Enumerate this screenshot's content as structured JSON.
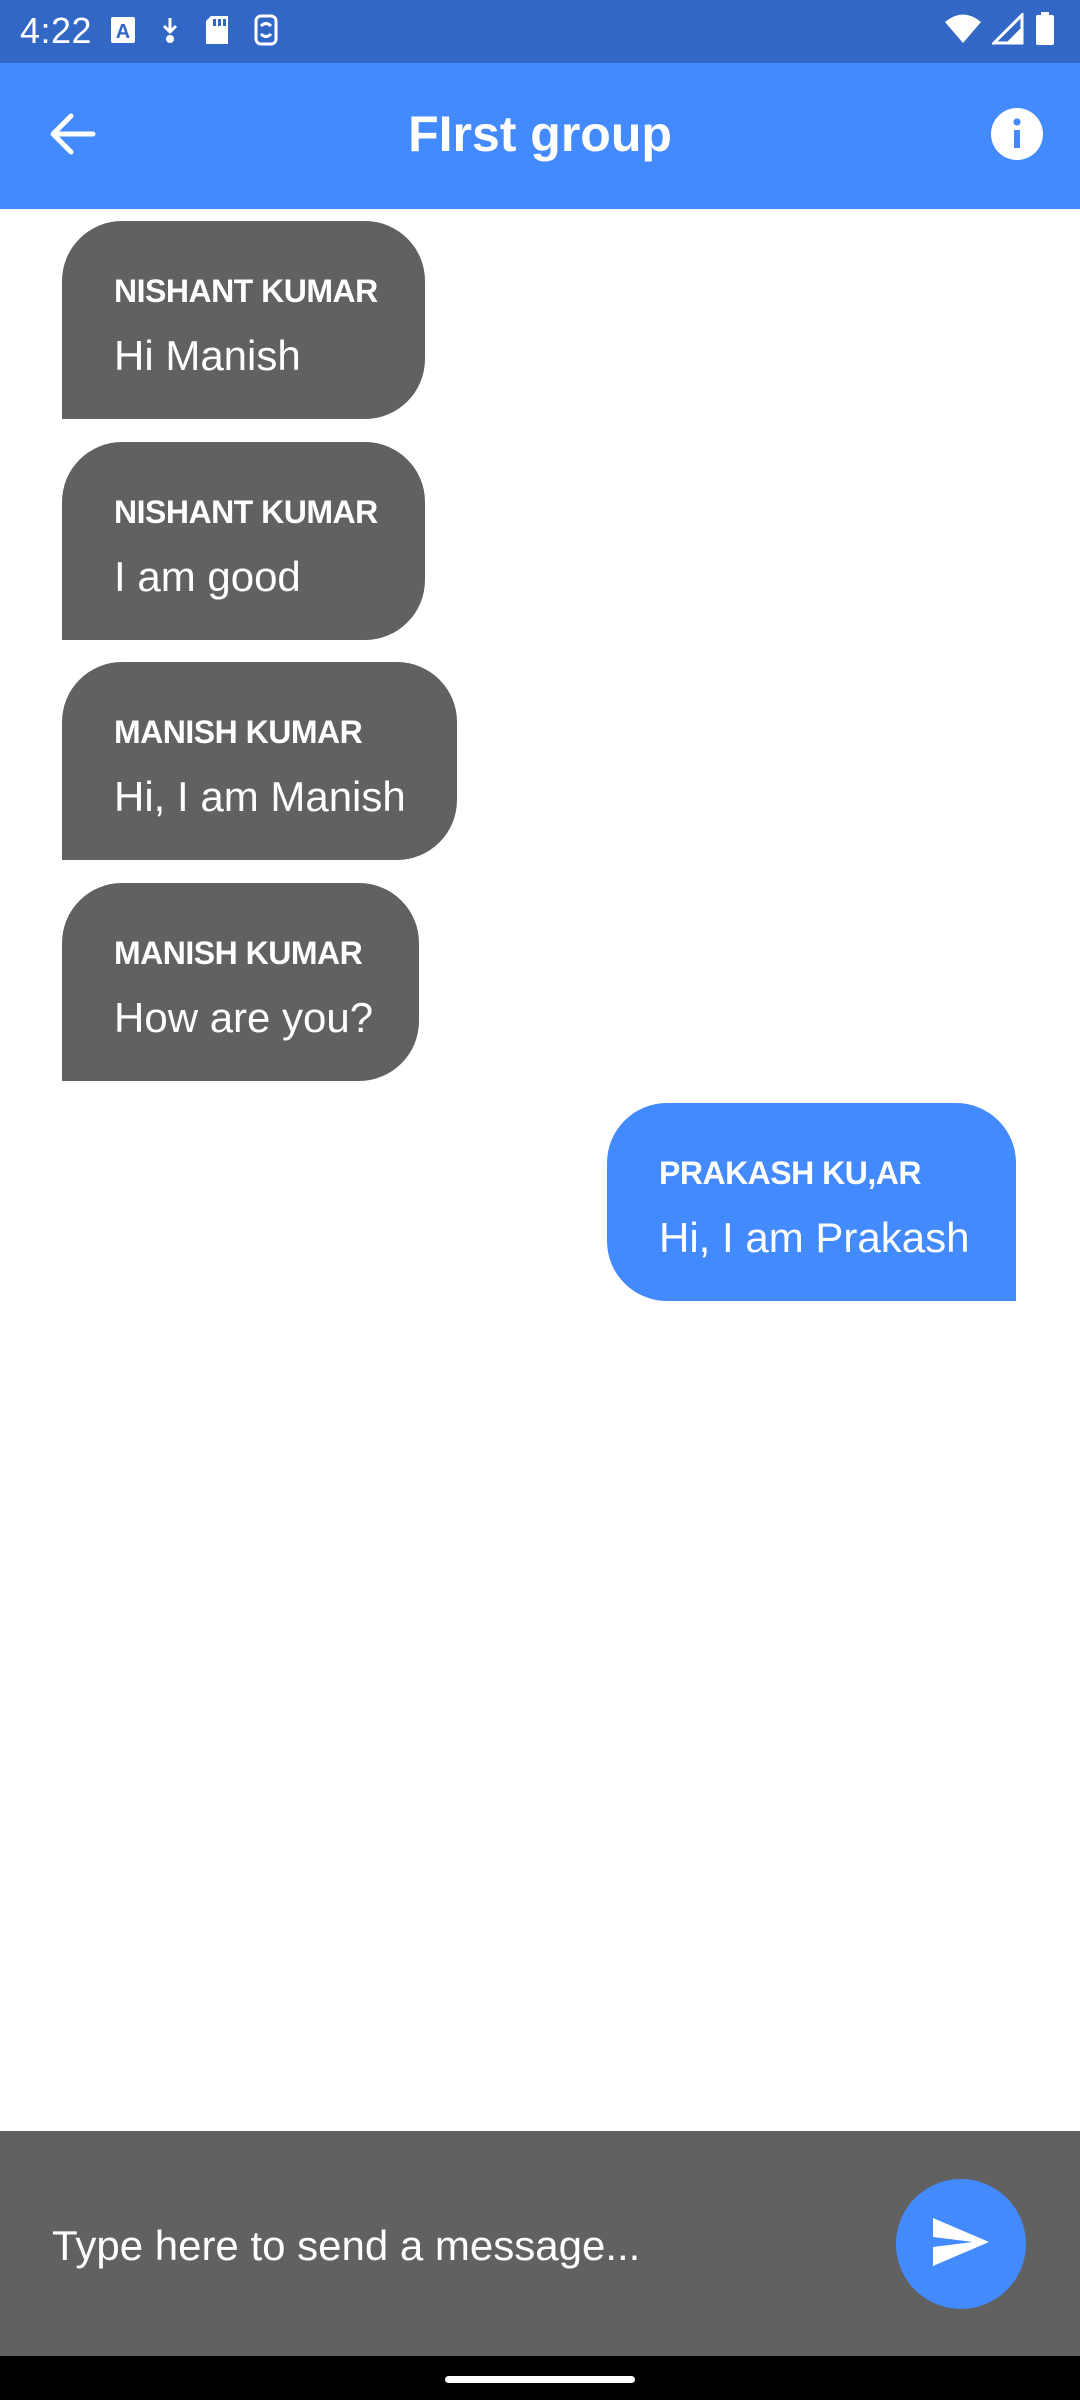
{
  "status_bar": {
    "time": "4:22",
    "left_icons": [
      "font-icon",
      "download-icon",
      "sd-card-icon",
      "sync-icon"
    ],
    "right_icons": [
      "wifi-icon",
      "signal-icon",
      "battery-icon"
    ]
  },
  "app_bar": {
    "title": "FIrst group",
    "back_icon": "arrow-back-icon",
    "info_icon": "info-icon"
  },
  "messages": [
    {
      "sender": "NISHANT KUMAR",
      "text": "Hi Manish",
      "direction": "incoming"
    },
    {
      "sender": "NISHANT KUMAR",
      "text": "I am good",
      "direction": "incoming"
    },
    {
      "sender": "MANISH KUMAR",
      "text": "Hi, I am Manish",
      "direction": "incoming"
    },
    {
      "sender": "MANISH KUMAR",
      "text": "How are you?",
      "direction": "incoming"
    },
    {
      "sender": "PRAKASH KU,AR",
      "text": "Hi, I am Prakash",
      "direction": "outgoing"
    }
  ],
  "composer": {
    "placeholder": "Type here to send a message...",
    "value": "",
    "send_icon": "send-icon"
  },
  "colors": {
    "status_bar": "#3367c6",
    "accent": "#448aff",
    "incoming_bubble": "#616161",
    "composer_bg": "#616161"
  }
}
